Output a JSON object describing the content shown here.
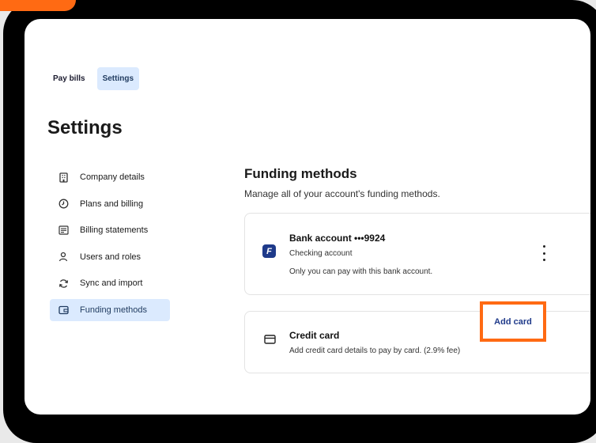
{
  "tabs": [
    {
      "label": "Pay bills",
      "active": false
    },
    {
      "label": "Settings",
      "active": true
    }
  ],
  "page_title": "Settings",
  "sidebar": {
    "items": [
      {
        "label": "Company details",
        "icon": "building-icon"
      },
      {
        "label": "Plans and billing",
        "icon": "plan-icon"
      },
      {
        "label": "Billing statements",
        "icon": "statement-icon"
      },
      {
        "label": "Users and roles",
        "icon": "user-icon"
      },
      {
        "label": "Sync and import",
        "icon": "sync-icon"
      },
      {
        "label": "Funding methods",
        "icon": "wallet-icon",
        "active": true
      }
    ]
  },
  "funding": {
    "title": "Funding methods",
    "subtitle": "Manage all of your account's funding methods.",
    "bank": {
      "logo_letter": "F",
      "title": "Bank account •••9924",
      "type": "Checking account",
      "note": "Only you can pay with this bank account."
    },
    "credit": {
      "title": "Credit card",
      "description": "Add credit card details to pay by card. (2.9% fee)",
      "button": "Add card"
    }
  },
  "colors": {
    "accent": "#ff6a13",
    "active_bg": "#dbeafe",
    "brand_blue": "#1e3a8a"
  }
}
